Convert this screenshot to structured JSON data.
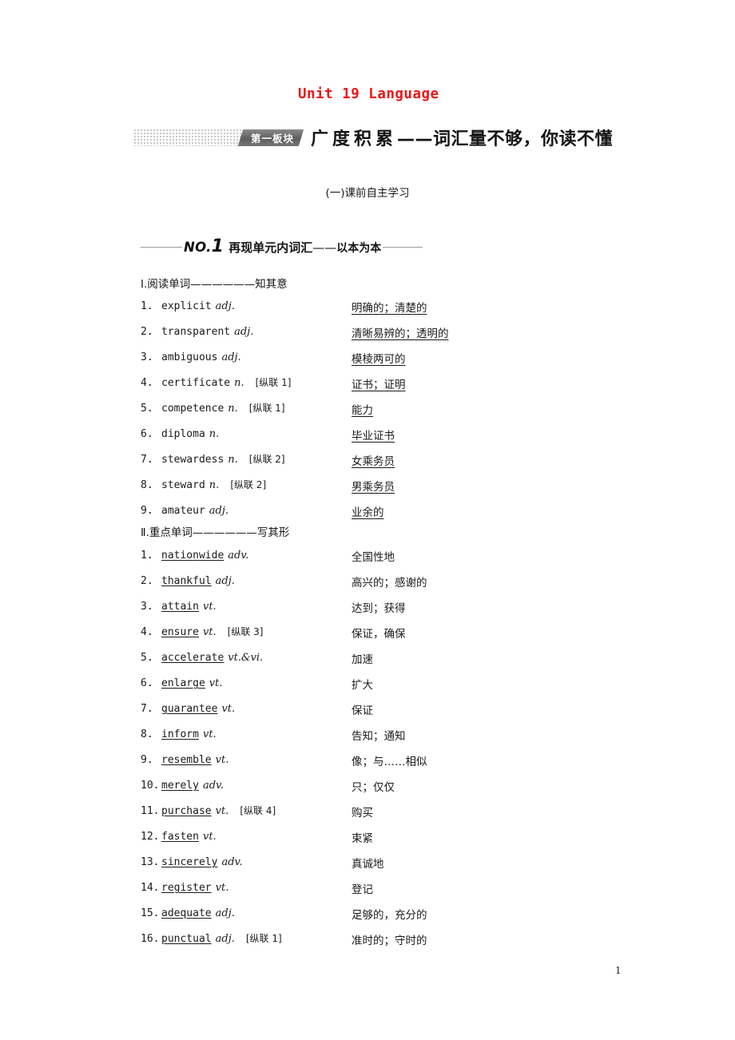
{
  "document": {
    "unit_title": "Unit 19 Language",
    "title_color": "#ee1515",
    "page_number": "1"
  },
  "banner": {
    "tag_label": "第一板块",
    "heading_main": "广度积累",
    "heading_dash": "——",
    "heading_sub": "词汇量不够，你读不懂"
  },
  "subheading": "(一)课前自主学习",
  "no_section": {
    "label_prefix": "NO.",
    "label_number": "1",
    "title": "再现单元内词汇",
    "dash": "——",
    "suffix": "以本为本"
  },
  "section1": {
    "heading": "Ⅰ.阅读单词——————知其意",
    "word_underlined": false,
    "meaning_underlined": true,
    "items": [
      {
        "num": "1.",
        "word": "explicit",
        "pos": "adj.",
        "tag": "",
        "meaning": "明确的；清楚的"
      },
      {
        "num": "2.",
        "word": "transparent",
        "pos": "adj.",
        "tag": "",
        "meaning": "清晰易辨的；透明的"
      },
      {
        "num": "3.",
        "word": "ambiguous",
        "pos": "adj.",
        "tag": "",
        "meaning": "模棱两可的"
      },
      {
        "num": "4.",
        "word": "certificate",
        "pos": "n.",
        "tag": "[纵联 1]",
        "meaning": "证书；证明"
      },
      {
        "num": "5.",
        "word": "competence",
        "pos": "n.",
        "tag": "[纵联 1]",
        "meaning": "能力"
      },
      {
        "num": "6.",
        "word": "diploma",
        "pos": "n.",
        "tag": "",
        "meaning": "毕业证书"
      },
      {
        "num": "7.",
        "word": "stewardess",
        "pos": "n.",
        "tag": "[纵联 2]",
        "meaning": "女乘务员"
      },
      {
        "num": "8.",
        "word": "steward",
        "pos": "n.",
        "tag": "[纵联 2]",
        "meaning": "男乘务员"
      },
      {
        "num": "9.",
        "word": "amateur",
        "pos": "adj.",
        "tag": "",
        "meaning": "业余的"
      }
    ]
  },
  "section2": {
    "heading": "Ⅱ.重点单词——————写其形",
    "word_underlined": true,
    "meaning_underlined": false,
    "items": [
      {
        "num": "1.",
        "word": "nationwide",
        "pos": "adv.",
        "tag": "",
        "meaning": "全国性地"
      },
      {
        "num": "2.",
        "word": "thankful",
        "pos": "adj.",
        "tag": "",
        "meaning": "高兴的；感谢的"
      },
      {
        "num": "3.",
        "word": "attain",
        "pos": "vt.",
        "tag": "",
        "meaning": "达到；获得"
      },
      {
        "num": "4.",
        "word": "ensure",
        "pos": "vt.",
        "tag": "[纵联 3]",
        "meaning": "保证，确保"
      },
      {
        "num": "5.",
        "word": "accelerate",
        "pos": "vt.&vi.",
        "tag": "",
        "meaning": "加速"
      },
      {
        "num": "6.",
        "word": "enlarge",
        "pos": "vt.",
        "tag": "",
        "meaning": "扩大"
      },
      {
        "num": "7.",
        "word": "guarantee",
        "pos": "vt.",
        "tag": "",
        "meaning": "保证"
      },
      {
        "num": "8.",
        "word": "inform",
        "pos": "vt.",
        "tag": "",
        "meaning": "告知；通知"
      },
      {
        "num": "9.",
        "word": "resemble",
        "pos": "vt.",
        "tag": "",
        "meaning": "像；与……相似"
      },
      {
        "num": "10.",
        "word": "merely",
        "pos": "adv.",
        "tag": "",
        "meaning": "只；仅仅"
      },
      {
        "num": "11.",
        "word": "purchase",
        "pos": "vt.",
        "tag": "[纵联 4]",
        "meaning": "购买"
      },
      {
        "num": "12.",
        "word": "fasten",
        "pos": "vt.",
        "tag": "",
        "meaning": "束紧"
      },
      {
        "num": "13.",
        "word": "sincerely",
        "pos": "adv.",
        "tag": "",
        "meaning": "真诚地"
      },
      {
        "num": "14.",
        "word": "register",
        "pos": "vt.",
        "tag": "",
        "meaning": "登记"
      },
      {
        "num": "15.",
        "word": "adequate",
        "pos": "adj.",
        "tag": "",
        "meaning": "足够的，充分的"
      },
      {
        "num": "16.",
        "word": "punctual",
        "pos": "adj.",
        "tag": "[纵联 1]",
        "meaning": "准时的；守时的"
      }
    ]
  }
}
